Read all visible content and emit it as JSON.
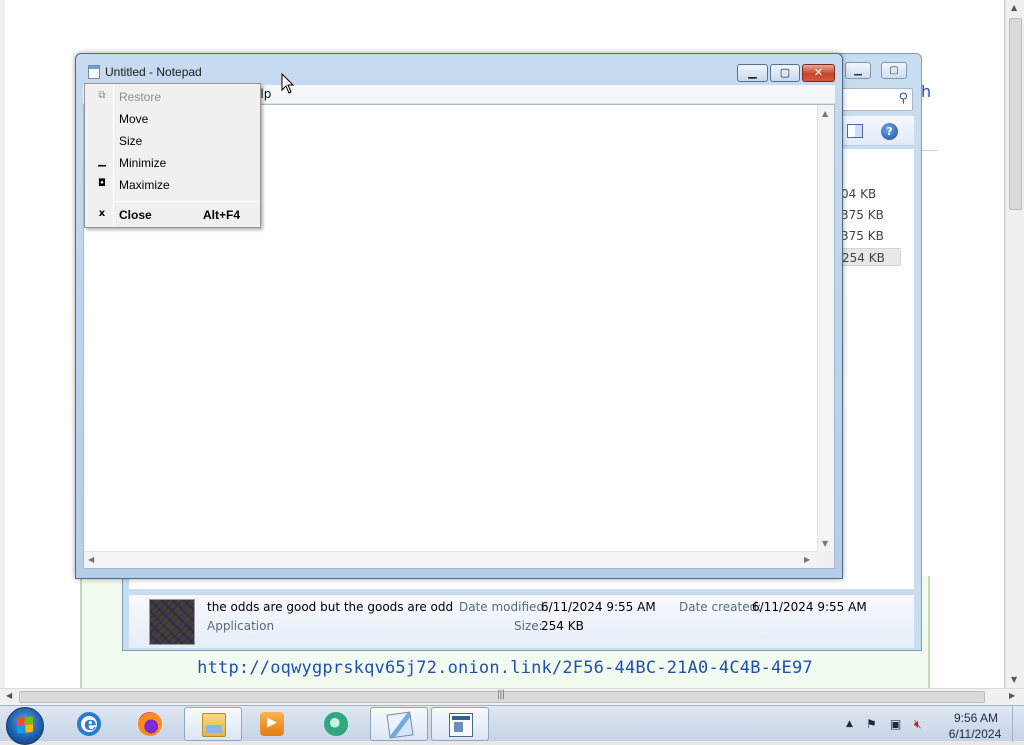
{
  "notepad": {
    "title": "Untitled - Notepad",
    "menu_help_fragment": "elp",
    "minimize_glyph": "▁",
    "maximize_glyph": "▢",
    "close_glyph": "✕"
  },
  "system_menu": {
    "items": [
      {
        "label": "Restore",
        "icon": "⧉",
        "disabled": true,
        "shortcut": ""
      },
      {
        "label": "Move",
        "icon": "",
        "disabled": false,
        "shortcut": ""
      },
      {
        "label": "Size",
        "icon": "",
        "disabled": false,
        "shortcut": ""
      },
      {
        "label": "Minimize",
        "icon": "▁",
        "disabled": false,
        "shortcut": ""
      },
      {
        "label": "Maximize",
        "icon": "◘",
        "disabled": false,
        "shortcut": ""
      },
      {
        "label": "Close",
        "icon": "x",
        "disabled": false,
        "shortcut": "Alt+F4"
      }
    ]
  },
  "explorer": {
    "sizes": [
      "04 KB",
      "375 KB",
      "375 KB",
      "254 KB"
    ],
    "details": {
      "file_name": "the odds are good but the goods are odd",
      "file_type": "Application",
      "date_modified_label": "Date modified:",
      "date_modified": "6/11/2024 9:55 AM",
      "date_created_label": "Date created:",
      "date_created": "6/11/2024 9:55 AM",
      "size_label": "Size:",
      "size": "254 KB"
    },
    "edge_text": "h"
  },
  "browser": {
    "link": "http://oqwygprskqv65j72.onion.link/2F56-44BC-21A0-4C4B-4E97"
  },
  "taskbar": {
    "apps": [
      "internet-explorer",
      "firefox",
      "windows-explorer",
      "media-player",
      "green-app",
      "notepad",
      "cmd-window"
    ],
    "active_apps": [
      "windows-explorer",
      "notepad",
      "cmd-window"
    ],
    "clock_time": "9:56 AM",
    "clock_date": "6/11/2024"
  },
  "colors": {
    "link": "#1f4fb0",
    "window_frame": "#c7daf0",
    "close_button": "#c7432b"
  }
}
